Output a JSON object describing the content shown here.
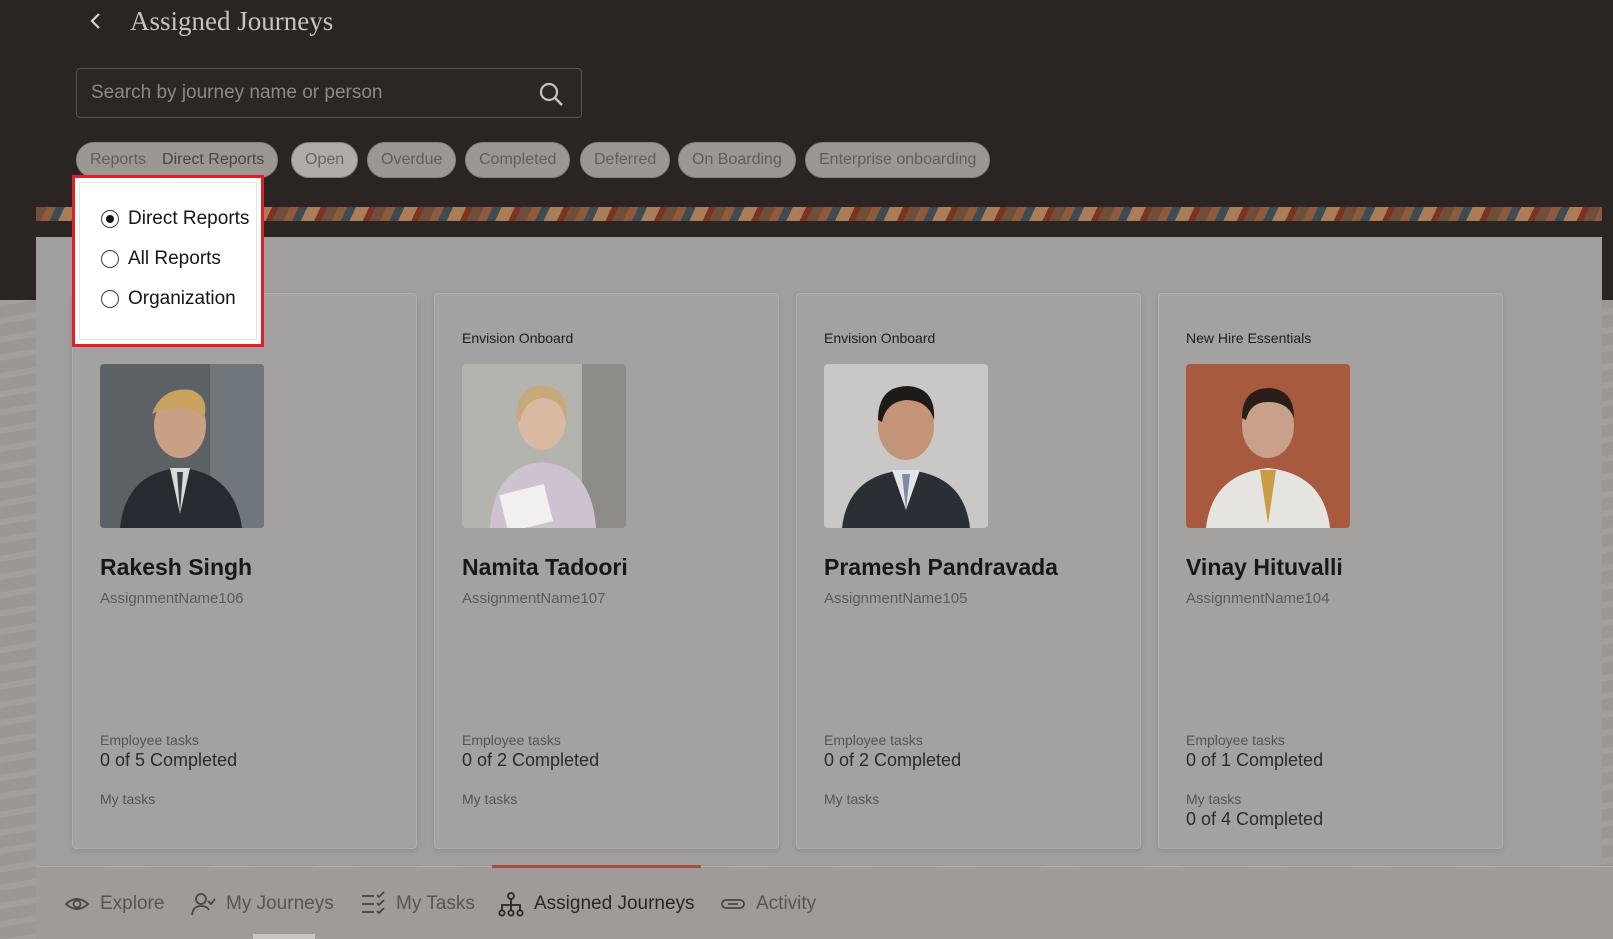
{
  "header": {
    "title": "Assigned Journeys",
    "search_placeholder": "Search by journey name or person"
  },
  "filters": {
    "reports": {
      "label": "Reports",
      "value": "Direct Reports"
    },
    "chips": [
      "Open",
      "Overdue",
      "Completed",
      "Deferred",
      "On Boarding",
      "Enterprise onboarding"
    ]
  },
  "reports_menu": {
    "options": [
      {
        "label": "Direct Reports",
        "selected": true
      },
      {
        "label": "All Reports",
        "selected": false
      },
      {
        "label": "Organization",
        "selected": false
      }
    ]
  },
  "cards": [
    {
      "journey": "",
      "name": "Rakesh Singh",
      "assignment": "AssignmentName106",
      "employee_tasks_label": "Employee tasks",
      "employee_tasks": "0 of 5 Completed",
      "my_tasks_label": "My tasks",
      "my_tasks": ""
    },
    {
      "journey": "Envision Onboard",
      "name": "Namita Tadoori",
      "assignment": "AssignmentName107",
      "employee_tasks_label": "Employee tasks",
      "employee_tasks": "0 of 2 Completed",
      "my_tasks_label": "My tasks",
      "my_tasks": ""
    },
    {
      "journey": "Envision Onboard",
      "name": "Pramesh Pandravada",
      "assignment": "AssignmentName105",
      "employee_tasks_label": "Employee tasks",
      "employee_tasks": "0 of 2 Completed",
      "my_tasks_label": "My tasks",
      "my_tasks": ""
    },
    {
      "journey": "New Hire Essentials",
      "name": "Vinay Hituvalli",
      "assignment": "AssignmentName104",
      "employee_tasks_label": "Employee tasks",
      "employee_tasks": "0 of 1 Completed",
      "my_tasks_label": "My tasks",
      "my_tasks": "0 of 4 Completed"
    }
  ],
  "bottom_nav": {
    "items": [
      {
        "label": "Explore",
        "icon": "eye-icon"
      },
      {
        "label": "My Journeys",
        "icon": "person-icon"
      },
      {
        "label": "My Tasks",
        "icon": "checklist-icon"
      },
      {
        "label": "Assigned Journeys",
        "icon": "org-chart-icon",
        "active": true
      },
      {
        "label": "Activity",
        "icon": "link-icon"
      }
    ]
  },
  "colors": {
    "header_bg": "#2a2523",
    "highlight_border": "#e21e26",
    "active_tab_underline": "#a0533c"
  }
}
